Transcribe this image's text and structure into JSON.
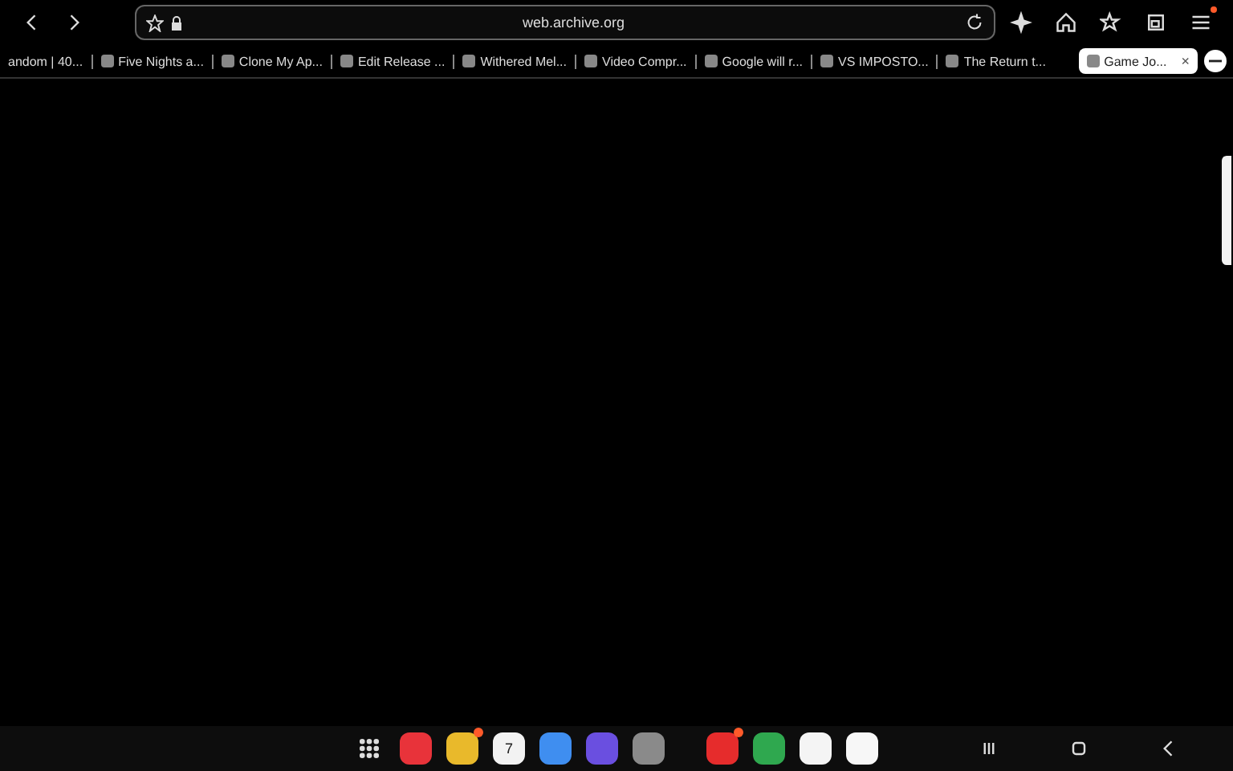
{
  "toolbar": {
    "url": "web.archive.org",
    "menu_notification": true
  },
  "tabs": [
    {
      "title": "andom | 40...",
      "selected": false
    },
    {
      "title": "Five Nights a...",
      "selected": false
    },
    {
      "title": "Clone My Ap...",
      "selected": false
    },
    {
      "title": "Edit Release ...",
      "selected": false
    },
    {
      "title": "Withered Mel...",
      "selected": false
    },
    {
      "title": "Video Compr...",
      "selected": false
    },
    {
      "title": "Google will r...",
      "selected": false
    },
    {
      "title": "VS IMPOSTO...",
      "selected": false
    },
    {
      "title": "The Return t...",
      "selected": false
    },
    {
      "title": "Game Jo...",
      "selected": true
    }
  ],
  "close_tab": "×",
  "dock": {
    "apps": [
      {
        "kind": "app",
        "color": "#e8333a",
        "badge": false
      },
      {
        "kind": "app",
        "color": "#e9b92b",
        "badge": true
      },
      {
        "kind": "calendar",
        "color": "#f2f2f2",
        "label": "7",
        "badge": false
      },
      {
        "kind": "app",
        "color": "#3f8ef0",
        "badge": false
      },
      {
        "kind": "app",
        "color": "#6a4fe0",
        "badge": false
      },
      {
        "kind": "app",
        "color": "#8a8a8a",
        "badge": false
      },
      {
        "kind": "divider"
      },
      {
        "kind": "app",
        "color": "#e62c2c",
        "badge": true
      },
      {
        "kind": "app",
        "color": "#2fa84f",
        "badge": false
      },
      {
        "kind": "app",
        "color": "#f4f4f4",
        "badge": false
      },
      {
        "kind": "app",
        "color": "#f7f7f7",
        "badge": false
      }
    ]
  }
}
